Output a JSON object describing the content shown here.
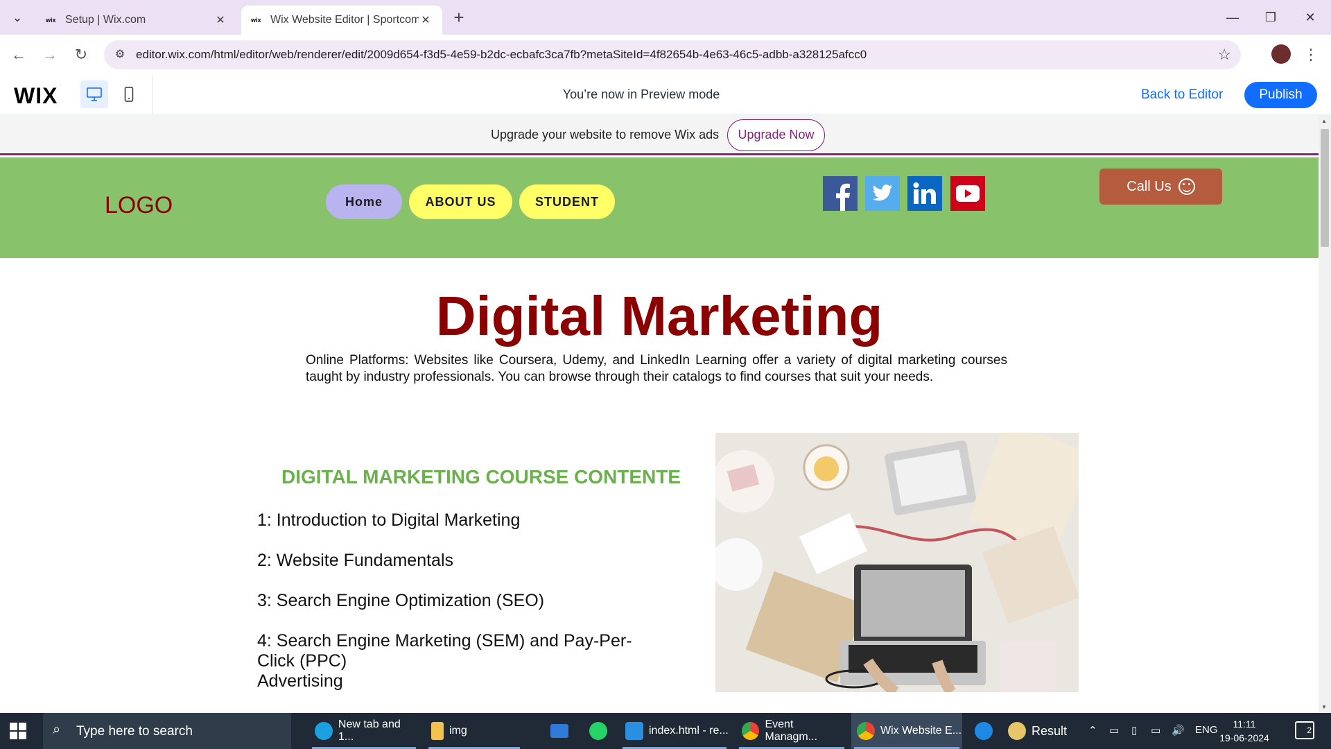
{
  "browser": {
    "tabs": [
      {
        "favicon": "wix",
        "title": "Setup | Wix.com"
      },
      {
        "favicon": "wix",
        "title": "Wix Website Editor | Sportcomp"
      }
    ],
    "url": "editor.wix.com/html/editor/web/renderer/edit/2009d654-f3d5-4e59-b2dc-ecbafc3ca7fb?metaSiteId=4f82654b-4e63-46c5-adbb-a328125afcc0"
  },
  "wix_bar": {
    "logo": "WIX",
    "preview_message": "You’re now in Preview mode",
    "back_to_editor": "Back to Editor",
    "publish": "Publish"
  },
  "ad_strip": {
    "text": "Upgrade your website to remove Wix ads",
    "button": "Upgrade Now"
  },
  "site": {
    "logo": "LOGO",
    "nav": [
      "Home",
      "ABOUT US",
      "STUDENT"
    ],
    "call_us": "Call Us",
    "title": "Digital Marketing",
    "intro": "Online Platforms: Websites like Coursera, Udemy, and LinkedIn Learning offer a variety of digital marketing courses taught by industry professionals. You can browse through their catalogs to find courses that suit your needs.",
    "course_heading": "DIGITAL MARKETING COURSE CONTENTE",
    "course_items": [
      "1: Introduction to Digital Marketing",
      "2: Website Fundamentals",
      "3: Search Engine Optimization (SEO)",
      "4: Search Engine Marketing (SEM) and Pay-Per-Click (PPC)\nAdvertising"
    ],
    "colors": {
      "header_bg": "#88c26a",
      "title": "#8b0000",
      "course_heading": "#6ab04c",
      "nav_home": "#b9b3ef",
      "nav_other": "#ffff66",
      "call_us": "#b65c3e"
    }
  },
  "taskbar": {
    "search_placeholder": "Type here to search",
    "items": [
      {
        "icon": "edge-icon",
        "label": "New tab and 1..."
      },
      {
        "icon": "folder-icon",
        "label": "img"
      },
      {
        "icon": "mail-icon",
        "label": ""
      },
      {
        "icon": "whatsapp-icon",
        "label": ""
      },
      {
        "icon": "vscode-icon",
        "label": "index.html - re..."
      },
      {
        "icon": "chrome-icon",
        "label": "Event Managm..."
      },
      {
        "icon": "chrome-icon",
        "label": "Wix Website E..."
      },
      {
        "icon": "help-icon",
        "label": ""
      },
      {
        "icon": "result-icon",
        "label": "Result"
      }
    ],
    "language": "ENG",
    "time": "11:11",
    "date": "19-06-2024",
    "notifications": "2"
  }
}
